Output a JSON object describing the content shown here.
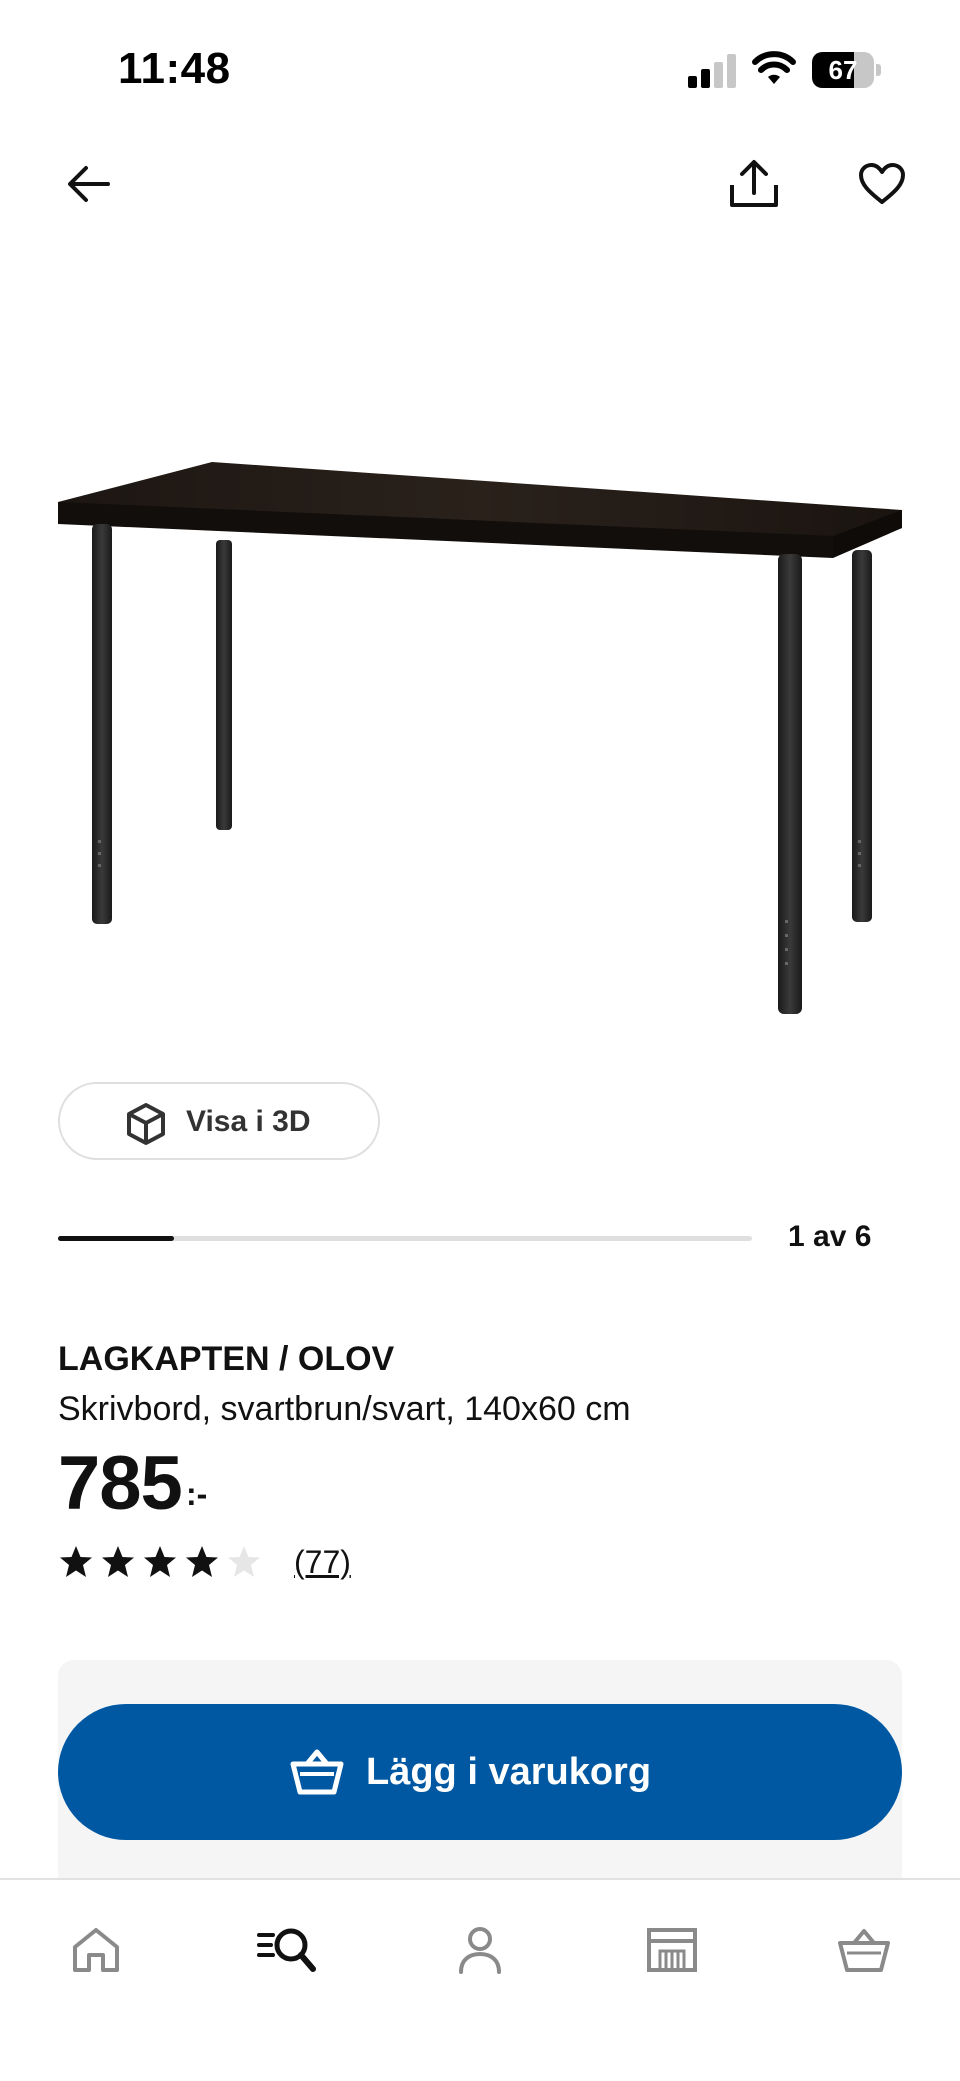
{
  "status_bar": {
    "time": "11:48",
    "battery_level": "67",
    "battery_fraction": 0.67,
    "signal_icon": "cellular-signal-icon",
    "wifi_icon": "wifi-icon"
  },
  "top_nav": {
    "back_icon": "arrow-left-icon",
    "share_icon": "share-icon",
    "favorite_icon": "heart-icon"
  },
  "gallery": {
    "image_subject": "black-brown desk with black legs",
    "view_3d_label": "Visa i 3D",
    "view_3d_icon": "cube-icon",
    "counter": "1 av 6",
    "current_index": 1,
    "total": 6
  },
  "product": {
    "name": "LAGKAPTEN / OLOV",
    "description": "Skrivbord, svartbrun/svart, 140x60 cm",
    "price": "785",
    "price_suffix": ":-",
    "rating": 4,
    "rating_max": 5,
    "review_count": "(77)"
  },
  "cart": {
    "add_label": "Lägg i varukorg",
    "add_icon": "basket-icon"
  },
  "bottom_nav": {
    "items": [
      {
        "icon": "home-icon"
      },
      {
        "icon": "search-icon",
        "active": true
      },
      {
        "icon": "profile-icon"
      },
      {
        "icon": "store-icon"
      },
      {
        "icon": "basket-icon"
      }
    ]
  },
  "colors": {
    "primary_blue": "#0058a3",
    "text": "#111111",
    "nav_inactive": "#8a8a8a",
    "panel_bg": "#f5f5f5"
  }
}
